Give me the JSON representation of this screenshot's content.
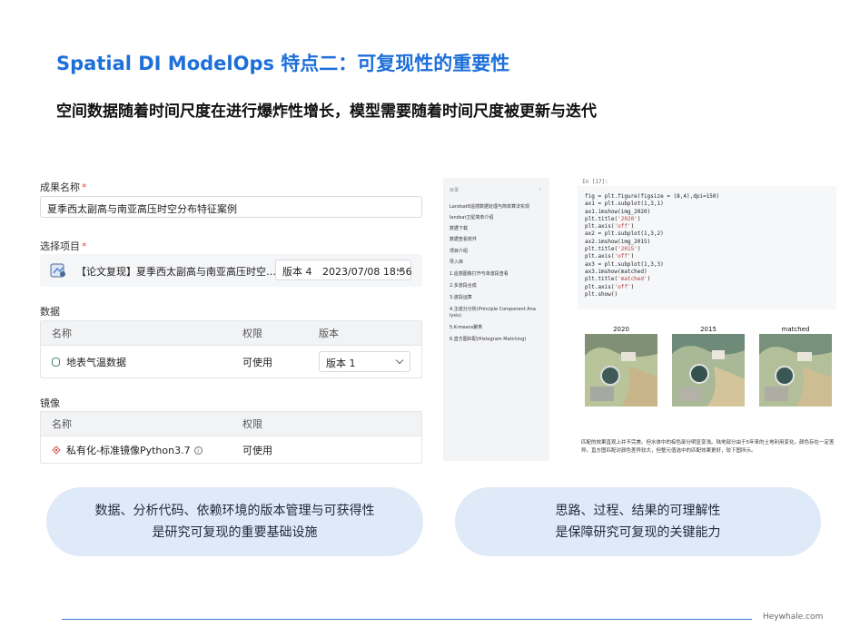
{
  "title": "Spatial DI ModelOps 特点二：可复现性的重要性",
  "subtitle": "空间数据随着时间尺度在进行爆炸性增长，模型需要随着时间尺度被更新与迭代",
  "form": {
    "result_name_label": "成果名称",
    "required_mark": "*",
    "result_name_value": "夏季西太副高与南亚高压时空分布特征案例",
    "project_label": "选择项目",
    "project_text": "【论文复现】夏季西太副高与南亚高压时空分布特征案例",
    "project_version": "版本 4",
    "project_date": "2023/07/08 18:56",
    "data_section": "数据",
    "data_columns": [
      "名称",
      "权限",
      "版本"
    ],
    "data_rows": [
      {
        "name": "地表气温数据",
        "permission": "可使用",
        "version": "版本 1"
      }
    ],
    "image_section": "镜像",
    "image_columns": [
      "名称",
      "权限"
    ],
    "image_rows": [
      {
        "name": "私有化-标准镜像Python3.7",
        "permission": "可使用"
      }
    ]
  },
  "notebook": {
    "toc_header": "目录",
    "toc_collapse": "‹",
    "toc_items": [
      "Landsat8遥感数据处理与简单算法实现",
      "landsat卫星简单介绍",
      "数据下载",
      "数据查看软件",
      "项目介绍",
      "导入库",
      "1.遥感图像打开与单波段查看",
      "2.多波段合成",
      "3.波段运算",
      "4.主成分分析(Principle Component Ana",
      "lysis)",
      "5.K-means聚类",
      "6.直方图匹配(Histogram Matching)"
    ],
    "cell_label": "In [17]:",
    "code_lines": [
      "fig = plt.figure(figsize = (8,4),dpi=150)",
      "ax1 = plt.subplot(1,3,1)",
      "ax1.imshow(img_2020)",
      "plt.title('2020')",
      "plt.axis('off')",
      "ax2 = plt.subplot(1,3,2)",
      "ax2.imshow(img_2015)",
      "plt.title('2015')",
      "plt.axis('off')",
      "ax3 = plt.subplot(1,3,3)",
      "ax3.imshow(matched)",
      "plt.title('matched')",
      "plt.axis('off')",
      "plt.show()"
    ],
    "image_titles": [
      "2020",
      "2015",
      "matched"
    ],
    "note": "匹配的效果直观上并不完美。但水体中的棕色部分明显变浅。陆地部分由于5年来的土地利用变化。颜色存在一定差异。直方图匹配对颜色差异较大，但整元值选中的匹配效果更好，较下图所示。"
  },
  "callouts": {
    "left_line1": "数据、分析代码、依赖环境的版本管理与可获得性",
    "left_line2": "是研究可复现的重要基础设施",
    "right_line1": "思路、过程、结果的可理解性",
    "right_line2": "是保障研究可复现的关键能力"
  },
  "footer": {
    "brand": "Heywhale.com"
  },
  "colors": {
    "title": "#1e6fd9",
    "pill": "#dfeaf8",
    "footer_line": "#3f7ad6"
  },
  "icons": [
    "project-file-icon",
    "database-icon",
    "python-icon",
    "info-icon",
    "chevron-down-icon"
  ]
}
